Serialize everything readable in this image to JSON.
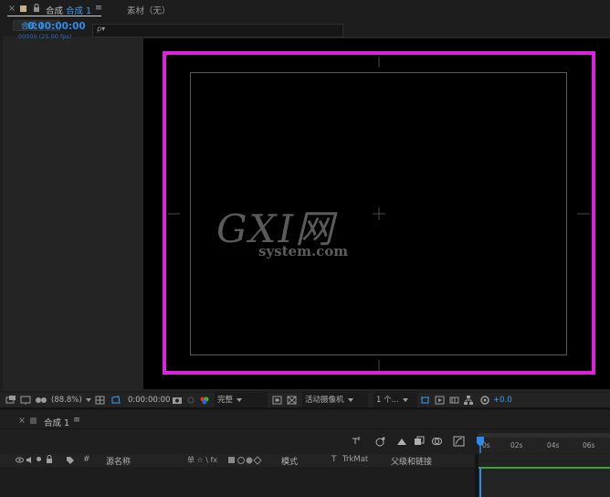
{
  "comp_panel": {
    "close_glyph": "×",
    "title_prefix": "合成",
    "active_comp": "合成 1",
    "menu_glyph": "≡",
    "footage_tab": "素材（无）",
    "sub_tab": "合成 1"
  },
  "watermark": {
    "line1": "GXI网",
    "line2": "system.com"
  },
  "viewer_toolbar": {
    "zoom": "(88.8%)",
    "timecode": "0:00:00:00",
    "resolution": "完整",
    "camera": "活动摄像机",
    "views": "1 个...",
    "exposure": "+0.0"
  },
  "timeline": {
    "close_glyph": "×",
    "tab_label": "合成 1",
    "menu_glyph": "≡",
    "timecode": "0:00:00:00",
    "timecode_sub": "00000 (25.00 fps)",
    "search_placeholder": "",
    "search_glyph": "ρ▾",
    "columns": {
      "hash": "#",
      "source_name": "源名称",
      "switches": "单 ☆ \\ fx",
      "mode": "模式",
      "t": "T",
      "trkmat": "TrkMat",
      "parent": "父级和链接"
    },
    "ruler_labels": [
      "0s",
      "02s",
      "04s",
      "06s"
    ]
  },
  "colors": {
    "accent_blue": "#2d8ceb",
    "safe_frame": "#dd22dd",
    "canvas": "#000000",
    "panel": "#1d1d1d"
  }
}
